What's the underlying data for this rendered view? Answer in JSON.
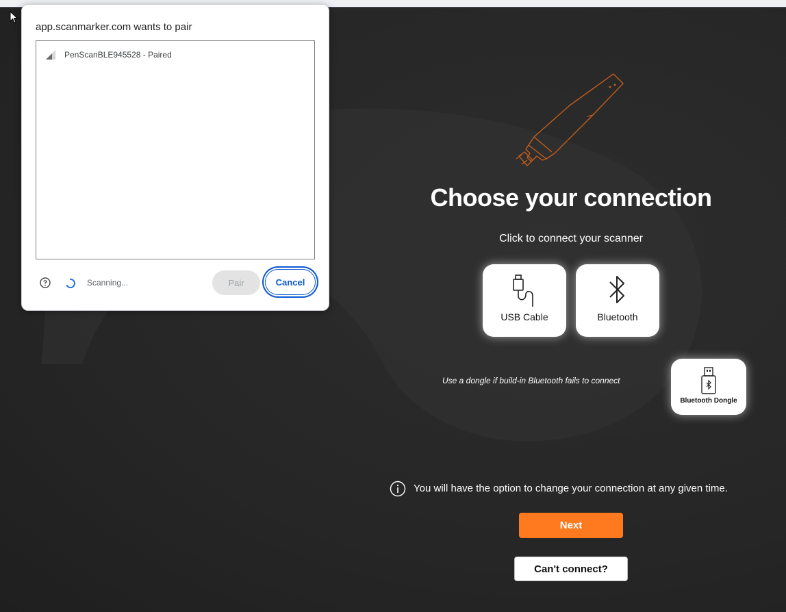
{
  "dialog": {
    "title": "app.scanmarker.com wants to pair",
    "devices": [
      {
        "label": "PenScanBLE945528 - Paired",
        "icon": "signal-strength-icon"
      }
    ],
    "status": "Scanning...",
    "pair_label": "Pair",
    "cancel_label": "Cancel"
  },
  "main": {
    "title": "Choose your connection",
    "subtitle": "Click to connect your scanner",
    "options": [
      {
        "label": "USB Cable",
        "icon": "usb-cable-icon"
      },
      {
        "label": "Bluetooth",
        "icon": "bluetooth-icon"
      }
    ],
    "dongle_hint": "Use a dongle if build-in Bluetooth fails to connect",
    "dongle_label": "Bluetooth Dongle",
    "info_text": "You will have the option to change your connection at any given time.",
    "next_label": "Next",
    "cant_connect_label": "Can't connect?"
  },
  "colors": {
    "accent": "#ff7a1f",
    "dialog_blue": "#0b57d0",
    "background": "#2a2a2a"
  }
}
